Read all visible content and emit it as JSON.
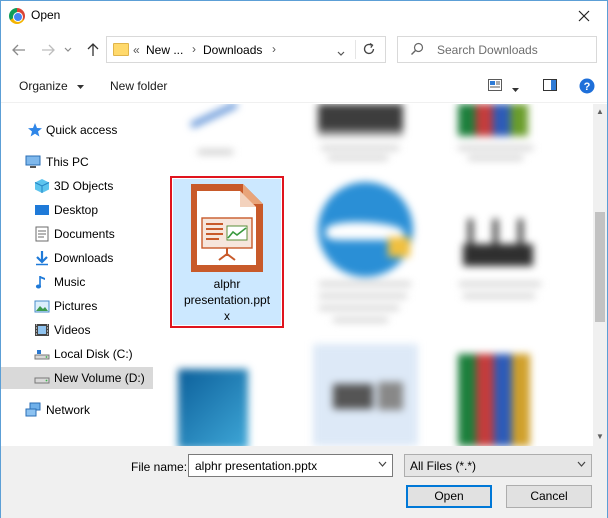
{
  "window": {
    "title": "Open",
    "close_icon": "close-icon"
  },
  "nav": {
    "back_icon": "arrow-left-icon",
    "forward_icon": "arrow-right-icon",
    "dropdown_icon": "chevron-down-icon",
    "up_icon": "arrow-up-icon",
    "address": {
      "prefix": "«",
      "crumbs": [
        "New ...",
        "Downloads"
      ]
    },
    "refresh_icon": "refresh-icon",
    "search_placeholder": "Search Downloads"
  },
  "toolbar": {
    "organize": "Organize",
    "new_folder": "New folder",
    "view_icon": "view-options-icon",
    "preview_icon": "preview-pane-icon",
    "help_icon": "help-icon"
  },
  "sidebar": {
    "items": [
      {
        "label": "Quick access",
        "icon": "star-icon"
      },
      {
        "label": "This PC",
        "icon": "computer-icon"
      },
      {
        "label": "3D Objects",
        "icon": "cube-icon"
      },
      {
        "label": "Desktop",
        "icon": "desktop-icon"
      },
      {
        "label": "Documents",
        "icon": "document-icon"
      },
      {
        "label": "Downloads",
        "icon": "download-icon"
      },
      {
        "label": "Music",
        "icon": "music-icon"
      },
      {
        "label": "Pictures",
        "icon": "pictures-icon"
      },
      {
        "label": "Videos",
        "icon": "video-icon"
      },
      {
        "label": "Local Disk (C:)",
        "icon": "drive-icon"
      },
      {
        "label": "New Volume (D:)",
        "icon": "drive-icon",
        "selected": true
      },
      {
        "label": "Network",
        "icon": "network-icon"
      }
    ]
  },
  "files": {
    "selected": {
      "name_line1": "alphr",
      "name_line2": "presentation.ppt",
      "name_line3": "x",
      "icon": "presentation-file-icon"
    }
  },
  "bottom": {
    "file_name_label": "File name:",
    "file_name_value": "alphr presentation.pptx",
    "file_type_value": "All Files (*.*)",
    "open_label": "Open",
    "cancel_label": "Cancel"
  },
  "colors": {
    "accent": "#0078d7",
    "selection": "#cce8ff",
    "highlight_border": "#e0141e"
  }
}
